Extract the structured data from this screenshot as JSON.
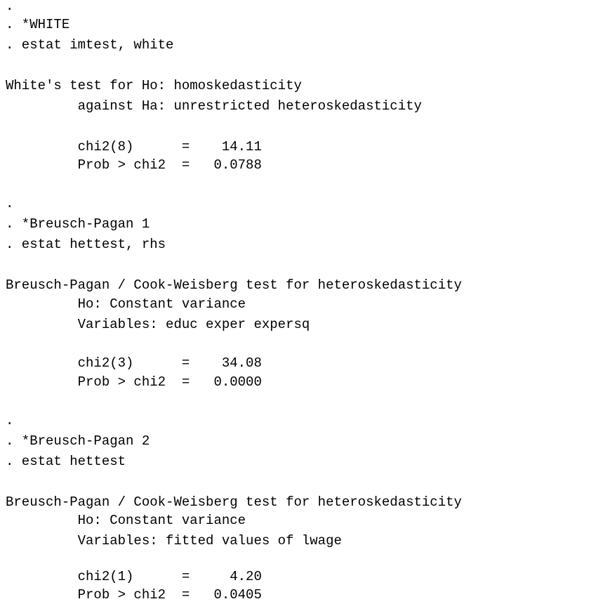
{
  "console": {
    "lines": [
      ".",
      ". *WHITE",
      ". estat imtest, white",
      "",
      "White's test for Ho: homoskedasticity",
      "         against Ha: unrestricted heteroskedasticity",
      "",
      "         chi2(8)      =    14.11",
      "         Prob > chi2  =   0.0788",
      "",
      ".",
      ". *Breusch-Pagan 1",
      ". estat hettest, rhs",
      "",
      "Breusch-Pagan / Cook-Weisberg test for heteroskedasticity",
      "         Ho: Constant variance",
      "         Variables: educ exper expersq",
      "",
      "         chi2(3)      =    34.08",
      "         Prob > chi2  =   0.0000",
      "",
      ".",
      ". *Breusch-Pagan 2",
      ". estat hettest",
      "",
      "Breusch-Pagan / Cook-Weisberg test for heteroskedasticity",
      "         Ho: Constant variance",
      "         Variables: fitted values of lwage",
      "",
      "         chi2(1)      =     4.20",
      "         Prob > chi2  =   0.0405"
    ]
  }
}
